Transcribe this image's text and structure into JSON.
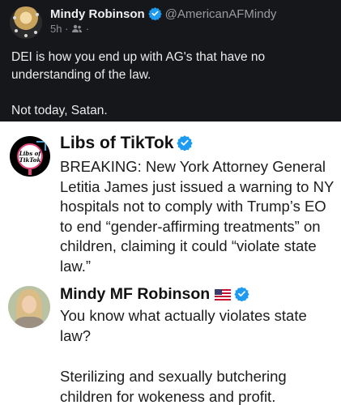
{
  "top_post": {
    "author_name": "Mindy Robinson",
    "handle": "@AmericanAFMindy",
    "time": "5h",
    "separator": "·",
    "text_line1": "DEI is how you end up with AG's that have no understanding of the law.",
    "text_line2": "Not today, Satan."
  },
  "embedded": {
    "post1": {
      "author_name": "Libs of TikTok",
      "avatar_text_line1": "Libs of",
      "avatar_text_line2": "TikTok",
      "text": "BREAKING: New York Attorney General Letitia James just issued a warning to NY hospitals not to comply with Trump’s EO to end “gender-affirming treatments” on children, claiming it could “violate state law.”"
    },
    "post2": {
      "author_name": "Mindy MF Robinson",
      "text_line1": "You know what actually violates state law?",
      "text_line2": "Sterilizing and sexually butchering children for wokeness and profit."
    }
  },
  "colors": {
    "verified_blue": "#1d9bf0",
    "dark_background": "#16171a",
    "embed_background": "#ffffff"
  },
  "icons": {
    "verified": "verified-badge-icon",
    "audience": "people-icon",
    "flag": "us-flag-icon"
  }
}
